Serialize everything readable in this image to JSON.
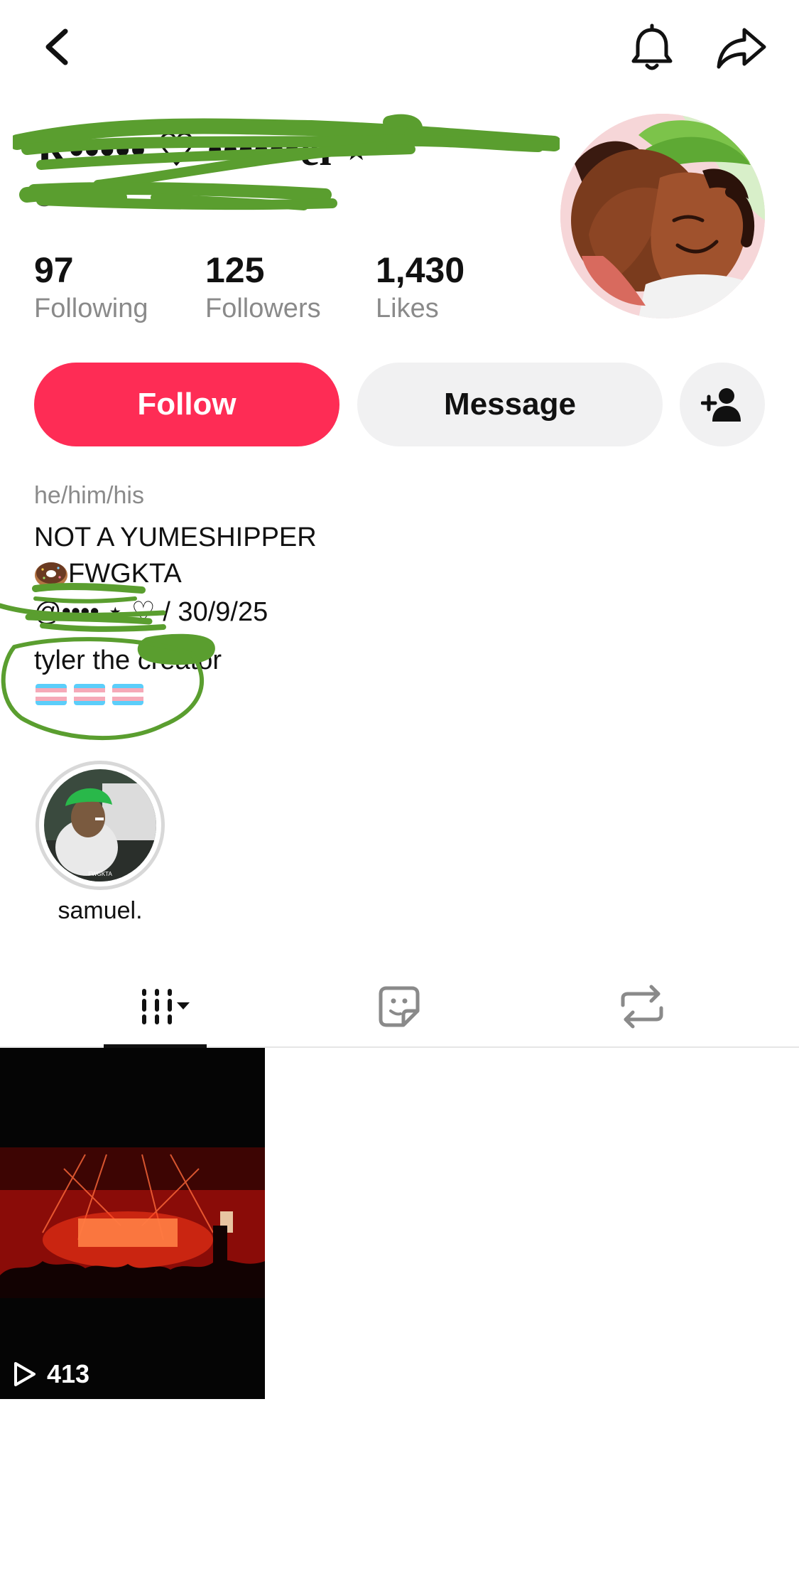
{
  "header": {
    "back_icon": "chevron-left-icon",
    "bell_icon": "bell-icon",
    "share_icon": "share-arrow-icon"
  },
  "profile": {
    "display_name": "R••••• ♡ ••••••el ⋆",
    "username": "@••••••••",
    "stats": {
      "following": {
        "value": "97",
        "label": "Following"
      },
      "followers": {
        "value": "125",
        "label": "Followers"
      },
      "likes": {
        "value": "1,430",
        "label": "Likes"
      }
    }
  },
  "actions": {
    "follow_label": "Follow",
    "message_label": "Message",
    "add_friend_icon": "person-plus-icon"
  },
  "bio": {
    "pronouns": "he/him/his",
    "line1": "NOT A YUMESHIPPER",
    "line2_emoji": "donut",
    "line2_text": "FWGKTA",
    "line3": "@•••• ⋆ ♡ / 30/9/25",
    "line4": "tyler the creator",
    "flags": [
      "transgender-flag",
      "transgender-flag",
      "transgender-flag"
    ]
  },
  "highlights": [
    {
      "label": "samuel.",
      "caption": "FWGKTA"
    }
  ],
  "tabs": [
    {
      "icon": "videos-grid-icon",
      "active": true,
      "has_dropdown": true
    },
    {
      "icon": "favorites-sticker-icon",
      "active": false
    },
    {
      "icon": "reposts-icon",
      "active": false
    }
  ],
  "videos": [
    {
      "views": "413",
      "icon": "play-icon"
    }
  ],
  "colors": {
    "accent": "#fe2c55",
    "button_gray": "#f1f1f2",
    "muted_text": "#8a8a8a",
    "scribble": "#5a9e2f"
  }
}
